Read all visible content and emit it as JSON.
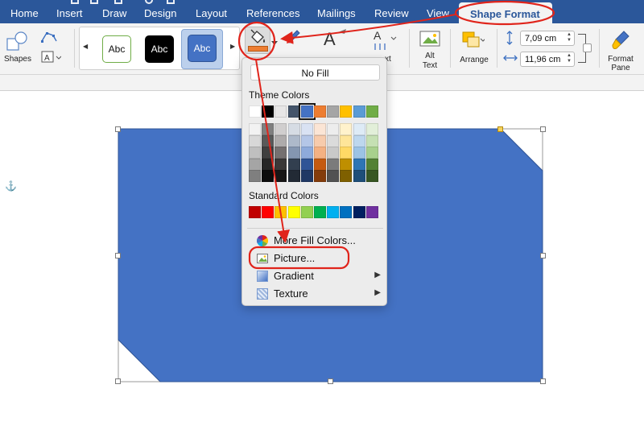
{
  "tabs": {
    "home": "Home",
    "insert": "Insert",
    "draw": "Draw",
    "design": "Design",
    "layout": "Layout",
    "references": "References",
    "mailings": "Mailings",
    "review": "Review",
    "view": "View",
    "shape_format": "Shape Format"
  },
  "ribbon": {
    "shapes_label": "Shapes",
    "style_preview": "Abc",
    "text_label_fragment": "xt",
    "alt_text_line1": "Alt",
    "alt_text_line2": "Text",
    "arrange_label": "Arrange",
    "height_value": "7,09 cm",
    "width_value": "11,96 cm",
    "format_pane_line1": "Format",
    "format_pane_line2": "Pane"
  },
  "menu": {
    "no_fill": "No Fill",
    "theme_colors_heading": "Theme Colors",
    "standard_colors_heading": "Standard Colors",
    "more_fill_colors": "More Fill Colors...",
    "picture": "Picture...",
    "gradient": "Gradient",
    "texture": "Texture",
    "theme_row": [
      "#ffffff",
      "#000000",
      "#e7e6e6",
      "#44546a",
      "#4472c4",
      "#ed7d31",
      "#a5a5a5",
      "#ffc000",
      "#5b9bd5",
      "#70ad47"
    ],
    "theme_shades": [
      [
        "#f2f2f2",
        "#7f7f7f",
        "#d0cece",
        "#d6dce4",
        "#d9e2f3",
        "#fbe5d5",
        "#ededed",
        "#fff2cc",
        "#deebf6",
        "#e2efd9"
      ],
      [
        "#d8d8d8",
        "#595959",
        "#aeabab",
        "#adb9ca",
        "#b4c6e7",
        "#f7cbac",
        "#dbdbdb",
        "#fee599",
        "#bdd7ee",
        "#c5e0b3"
      ],
      [
        "#bfbfbf",
        "#3f3f3f",
        "#757070",
        "#8496b0",
        "#8eaadb",
        "#f4b183",
        "#c9c9c9",
        "#ffd965",
        "#9cc3e5",
        "#a8d08d"
      ],
      [
        "#a5a5a5",
        "#262626",
        "#3a3838",
        "#323f4f",
        "#2f5496",
        "#c55a11",
        "#7b7b7b",
        "#bf8f00",
        "#2e75b5",
        "#538135"
      ],
      [
        "#7f7f7f",
        "#0c0c0c",
        "#171616",
        "#222a35",
        "#1f3864",
        "#833c0b",
        "#525252",
        "#7f6000",
        "#1e4e79",
        "#375623"
      ]
    ],
    "standard_row": [
      "#c00000",
      "#ff0000",
      "#ffc000",
      "#ffff00",
      "#92d050",
      "#00b050",
      "#00b0f0",
      "#0070c0",
      "#002060",
      "#7030a0"
    ]
  },
  "colors": {
    "tab_bar": "#2b579a",
    "shape_fill": "#4472c4",
    "annotation": "#e0241b",
    "fill_bucket_bar": "#ed7d31"
  },
  "icons": {
    "anchor": "⚓",
    "submenu_arrow": "▶",
    "gallery_left": "◀",
    "gallery_right": "▶"
  }
}
